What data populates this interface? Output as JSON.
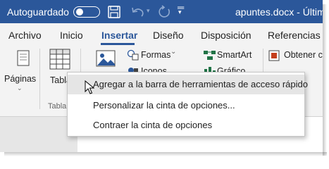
{
  "titlebar": {
    "autosave_label": "Autoguardado",
    "doc_title": "apuntes.docx  -  Última mod"
  },
  "tabs": [
    {
      "label": "Archivo",
      "active": false
    },
    {
      "label": "Inicio",
      "active": false
    },
    {
      "label": "Insertar",
      "active": true
    },
    {
      "label": "Diseño",
      "active": false
    },
    {
      "label": "Disposición",
      "active": false
    },
    {
      "label": "Referencias",
      "active": false
    }
  ],
  "ribbon": {
    "paginas_label": "Páginas",
    "tablas_button_label": "Tabla",
    "tablas_group_label": "Tabla",
    "formas_label": "Formas",
    "iconos_label": "Iconos",
    "smartart_label": "SmartArt",
    "grafico_label": "Gráfico",
    "obtener_label": "Obtener c"
  },
  "context_menu": {
    "items": [
      {
        "label": "Agregar a la barra de herramientas de acceso rápido",
        "highlighted": true
      },
      {
        "label": "Personalizar la cinta de opciones...",
        "highlighted": false
      },
      {
        "label": "Contraer la cinta de opciones",
        "highlighted": false
      }
    ]
  },
  "colors": {
    "titlebar": "#2b579a",
    "ribbon": "#f3f3f3",
    "menu_highlight": "#e5e5e5",
    "smartart_green": "#217346"
  }
}
